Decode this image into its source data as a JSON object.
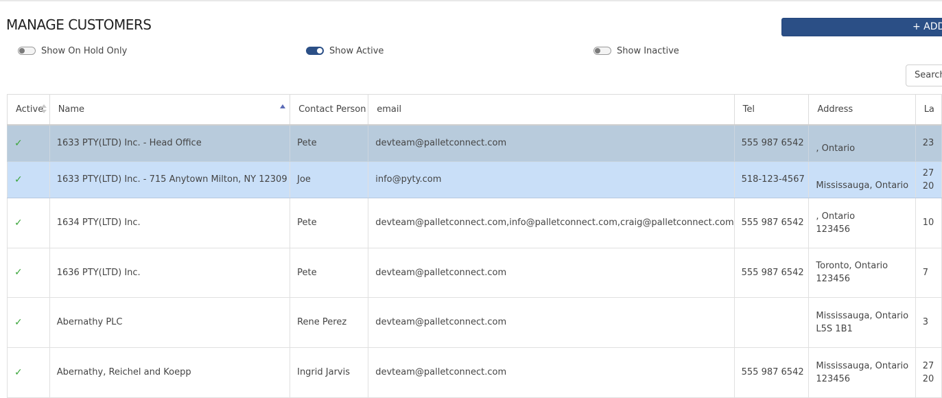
{
  "page": {
    "title": "MANAGE CUSTOMERS",
    "add_button": "+ ADD"
  },
  "filters": {
    "on_hold": {
      "label": "Show On Hold Only",
      "on": false
    },
    "active": {
      "label": "Show Active",
      "on": true
    },
    "inactive": {
      "label": "Show Inactive",
      "on": false
    }
  },
  "search": {
    "placeholder": "Search"
  },
  "table": {
    "columns": [
      "Active",
      "Name",
      "Contact Person",
      "email",
      "Tel",
      "Address",
      "La"
    ],
    "rows": [
      {
        "active": "✓",
        "name": "1633 PTY(LTD) Inc. - Head Office",
        "contact": "Pete",
        "email": "devteam@palletconnect.com",
        "tel": "555 987 6542",
        "address_line1": "",
        "address_line2": ", Ontario",
        "last": "23"
      },
      {
        "active": "✓",
        "name": "1633 PTY(LTD) Inc. - 715 Anytown Milton, NY 12309",
        "contact": "Joe",
        "email": "info@pyty.com",
        "tel": "518-123-4567",
        "address_line1": "",
        "address_line2": "Mississauga, Ontario",
        "last": "27",
        "last_line2": "20"
      },
      {
        "active": "✓",
        "name": "1634 PTY(LTD) Inc.",
        "contact": "Pete",
        "email": "devteam@palletconnect.com,info@palletconnect.com,craig@palletconnect.com",
        "tel": "555 987 6542",
        "address_line1": ", Ontario",
        "address_line2": "123456",
        "last": "10"
      },
      {
        "active": "✓",
        "name": "1636 PTY(LTD) Inc.",
        "contact": "Pete",
        "email": "devteam@palletconnect.com",
        "tel": "555 987 6542",
        "address_line1": "Toronto, Ontario",
        "address_line2": "123456",
        "last": "7"
      },
      {
        "active": "✓",
        "name": "Abernathy PLC",
        "contact": "Rene Perez",
        "email": "devteam@palletconnect.com",
        "tel": "",
        "address_line1": "Mississauga, Ontario",
        "address_line2": "L5S 1B1",
        "last": "3"
      },
      {
        "active": "✓",
        "name": "Abernathy, Reichel and Koepp",
        "contact": "Ingrid Jarvis",
        "email": "devteam@palletconnect.com",
        "tel": "555 987 6542",
        "address_line1": "Mississauga, Ontario",
        "address_line2": "123456",
        "last": "27",
        "last_line2": "20"
      }
    ]
  },
  "colors": {
    "accent": "#2b4f86",
    "selected_row_dark": "#b8cbdc",
    "selected_row_light": "#c9dff8",
    "check": "#3aa53a"
  }
}
